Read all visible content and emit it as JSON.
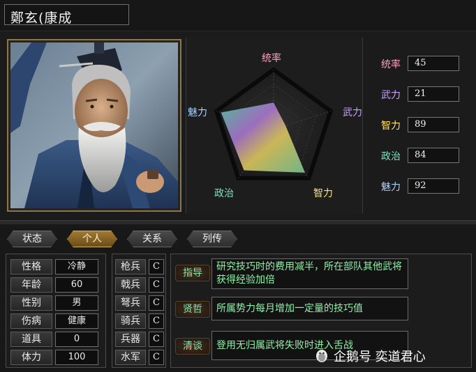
{
  "character": {
    "name": "鄭玄(康成"
  },
  "radar": {
    "labels": {
      "leadership": "统率",
      "war": "武力",
      "intelligence": "智力",
      "politics": "政治",
      "charm": "魅力"
    }
  },
  "stats": [
    {
      "key": "leadership",
      "label": "统率",
      "value": "45",
      "color": "#ff9fbf"
    },
    {
      "key": "war",
      "label": "武力",
      "value": "21",
      "color": "#c9a0ff"
    },
    {
      "key": "intelligence",
      "label": "智力",
      "value": "89",
      "color": "#ffe26b"
    },
    {
      "key": "politics",
      "label": "政治",
      "value": "84",
      "color": "#7fe3c0"
    },
    {
      "key": "charm",
      "label": "魅力",
      "value": "92",
      "color": "#aad0ff"
    }
  ],
  "tabs": [
    {
      "label": "状态",
      "active": false
    },
    {
      "label": "个人",
      "active": true
    },
    {
      "label": "关系",
      "active": false
    },
    {
      "label": "列传",
      "active": false
    }
  ],
  "personal": [
    {
      "label": "性格",
      "value": "冷静"
    },
    {
      "label": "年龄",
      "value": "60"
    },
    {
      "label": "性别",
      "value": "男"
    },
    {
      "label": "伤病",
      "value": "健康"
    },
    {
      "label": "道具",
      "value": "0"
    },
    {
      "label": "体力",
      "value": "100"
    }
  ],
  "troops": [
    {
      "label": "枪兵",
      "value": "C"
    },
    {
      "label": "戟兵",
      "value": "C"
    },
    {
      "label": "弩兵",
      "value": "C"
    },
    {
      "label": "骑兵",
      "value": "C"
    },
    {
      "label": "兵器",
      "value": "C"
    },
    {
      "label": "水军",
      "value": "C"
    }
  ],
  "skills": [
    {
      "name": "指导",
      "description": "研究技巧时的费用减半，所在部队其他武将获得经验加倍"
    },
    {
      "name": "贤哲",
      "description": "所属势力每月增加一定量的技巧值"
    },
    {
      "name": "清谈",
      "description": "登用无归属武将失败时进入舌战"
    }
  ],
  "watermark": {
    "text": "企鹅号 奕道君心",
    "icon": "penguin-icon"
  },
  "colors": {
    "accent_gold": "#d9b45c",
    "skill_text": "#8ff0a8",
    "skill_name": "#7fe6b4"
  }
}
